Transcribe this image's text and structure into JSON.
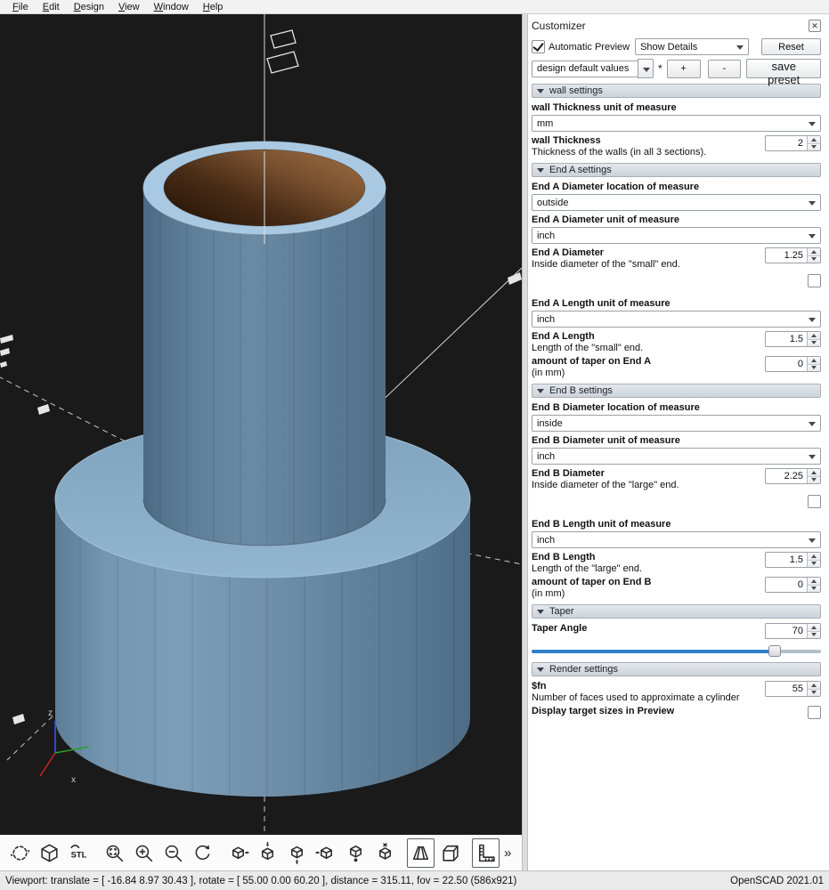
{
  "menu": {
    "items": [
      "File",
      "Edit",
      "Design",
      "View",
      "Window",
      "Help"
    ]
  },
  "customizer": {
    "title": "Customizer",
    "close_glyph": "✕",
    "automatic_preview_label": "Automatic Preview",
    "show_details_value": "Show Details",
    "reset_label": "Reset",
    "preset_value": "design default values",
    "modified_indicator": "*",
    "add_label": "+",
    "remove_label": "-",
    "save_preset_label": "save preset",
    "wall": {
      "header": "wall settings",
      "unit_label": "wall Thickness unit of measure",
      "unit_value": "mm",
      "thickness_label": "wall Thickness",
      "thickness_desc": "Thickness of the walls (in all 3 sections).",
      "thickness_value": "2"
    },
    "end_a": {
      "header": "End A settings",
      "location_label": "End A Diameter location of measure",
      "location_value": "outside",
      "diameter_unit_label": "End A Diameter unit of measure",
      "diameter_unit_value": "inch",
      "diameter_label": "End A Diameter",
      "diameter_desc": "Inside diameter of the \"small\" end.",
      "diameter_value": "1.25",
      "length_unit_label": "End A Length unit of measure",
      "length_unit_value": "inch",
      "length_label": "End A Length",
      "length_desc": "Length of the \"small\" end.",
      "length_value": "1.5",
      "taper_label": "amount of taper on End A",
      "taper_desc": "(in mm)",
      "taper_value": "0"
    },
    "end_b": {
      "header": "End B settings",
      "location_label": "End B Diameter location of measure",
      "location_value": "inside",
      "diameter_unit_label": "End B Diameter unit of measure",
      "diameter_unit_value": "inch",
      "diameter_label": "End B Diameter",
      "diameter_desc": "Inside diameter of the \"large\" end.",
      "diameter_value": "2.25",
      "length_unit_label": "End B Length unit of measure",
      "length_unit_value": "inch",
      "length_label": "End B Length",
      "length_desc": "Length of the \"large\" end.",
      "length_value": "1.5",
      "taper_label": "amount of taper on End B",
      "taper_desc": "(in mm)",
      "taper_value": "0"
    },
    "taper": {
      "header": "Taper",
      "angle_label": "Taper Angle",
      "angle_value": "70",
      "slider_position_pct": 84
    },
    "render": {
      "header": "Render settings",
      "fn_label": "$fn",
      "fn_desc": "Number of faces used to approximate a cylinder",
      "fn_value": "55",
      "display_label": "Display target sizes in Preview"
    }
  },
  "viewport": {
    "axis_z_label": "z",
    "axis_x_label": "x",
    "background_color": "#1a1a1a",
    "model_outer_color": "#6e8ca6",
    "model_rim_color": "#a9c9e2",
    "model_inner_color": "#8a5a34"
  },
  "toolbar": {
    "stl_label": "STL",
    "overflow_glyph": "»",
    "buttons": [
      "animate-icon",
      "cube-icon",
      "stl-export-icon",
      "zoom-all-icon",
      "zoom-in-icon",
      "zoom-out-icon",
      "reset-view-icon",
      "view-right-icon",
      "view-top-icon",
      "view-bottom-icon",
      "view-left-icon",
      "view-front-icon",
      "view-back-icon",
      "perspective-icon",
      "orthographic-icon",
      "measure-icon",
      "overflow-chevron"
    ]
  },
  "statusbar": {
    "left": "Viewport: translate = [ -16.84 8.97 30.43 ], rotate = [ 55.00 0.00 60.20 ], distance = 315.11, fov = 22.50 (586x921)",
    "right": "OpenSCAD 2021.01"
  }
}
